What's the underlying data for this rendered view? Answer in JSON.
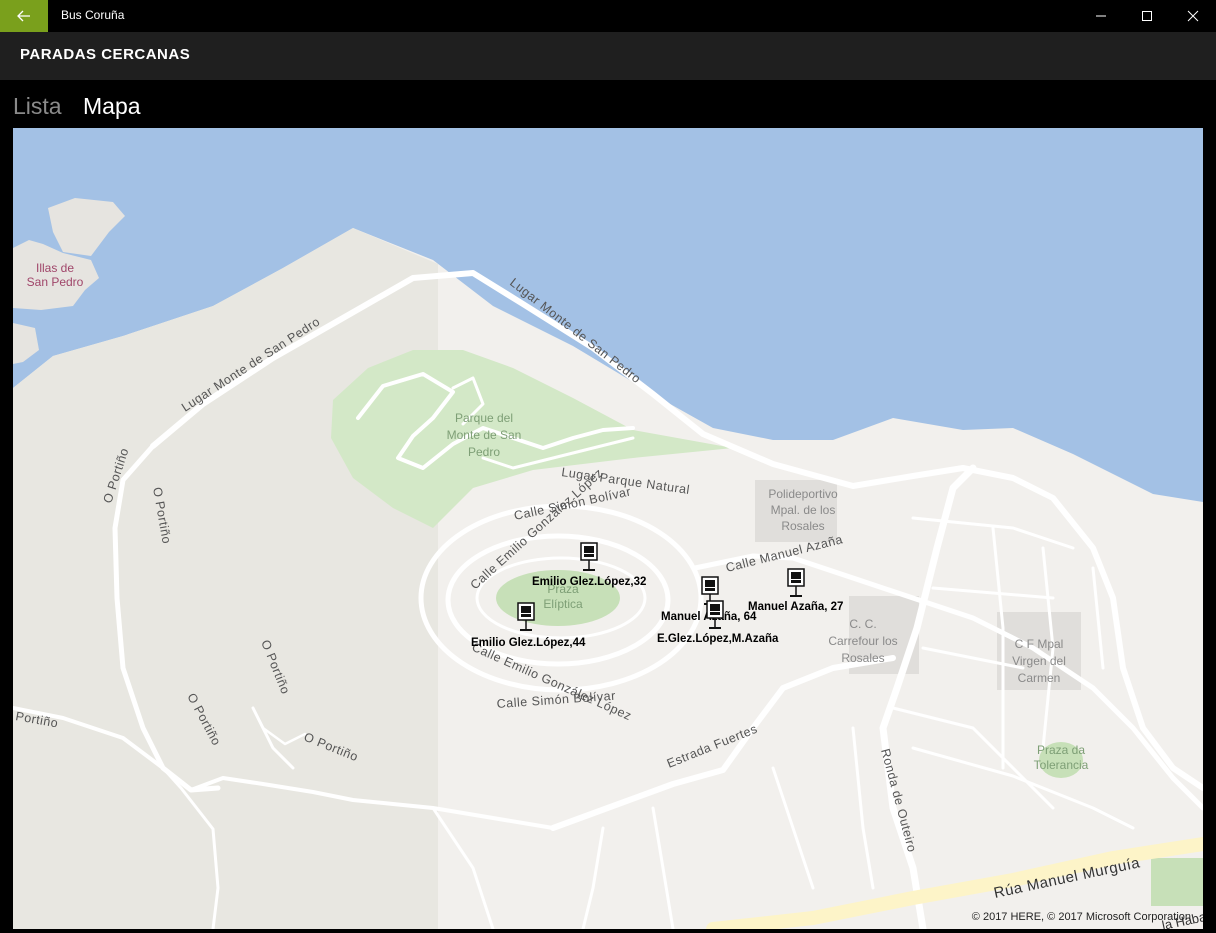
{
  "window": {
    "app_title": "Bus Coruña",
    "accent_color": "#7aa01c"
  },
  "header": {
    "title": "PARADAS CERCANAS"
  },
  "pivot": {
    "tabs": [
      {
        "label": "Lista",
        "active": false
      },
      {
        "label": "Mapa",
        "active": true
      }
    ]
  },
  "map": {
    "copyright": "© 2017 HERE, © 2017 Microsoft Corporation",
    "place_labels": {
      "illas_1": "Illas de",
      "illas_2": "San Pedro",
      "parque_1": "Parque del",
      "parque_2": "Monte de San",
      "parque_3": "Pedro",
      "polideportivo_1": "Polideportivo",
      "polideportivo_2": "Mpal. de los",
      "polideportivo_3": "Rosales",
      "praza_1": "Praza",
      "praza_2": "Elíptica",
      "cc_1": "C. C.",
      "cc_2": "Carrefour los",
      "cc_3": "Rosales",
      "cf_1": "C F Mpal",
      "cf_2": "Virgen del",
      "cf_3": "Carmen",
      "tolerancia_1": "Praza da",
      "tolerancia_2": "Tolerancia"
    },
    "street_labels": {
      "lugar_monte_left": "Lugar Monte de San Pedro",
      "lugar_monte_right": "Lugar Monte de San Pedro",
      "lugar_parque": "Lugar Parque Natural",
      "simon_top": "Calle Simón Bolívar",
      "simon_bottom": "Calle Simón Bolívar",
      "emilio_top": "Calle Emilio González López",
      "emilio_bottom": "Calle Emilio González López",
      "manuel_azana": "Calle Manuel Azaña",
      "estrada": "Estrada Fuertes",
      "ronda": "Ronda de Outeiro",
      "murguia": "Rúa Manuel Murguía",
      "portino_1": "O Portiño",
      "portino_2": "O Portiño",
      "portino_3": "O Portiño",
      "portino_4": "O Portiño",
      "portino_5": "O Portiño",
      "portino_6": "Portiño",
      "habana": "la Haba"
    },
    "bus_stops": [
      {
        "name": "Emilio Glez.López,32"
      },
      {
        "name": "Emilio Glez.López,44"
      },
      {
        "name": "Manuel Azaña, 64"
      },
      {
        "name": "E.Glez.López,M.Azaña"
      },
      {
        "name": "Manuel Azaña, 27"
      }
    ]
  }
}
